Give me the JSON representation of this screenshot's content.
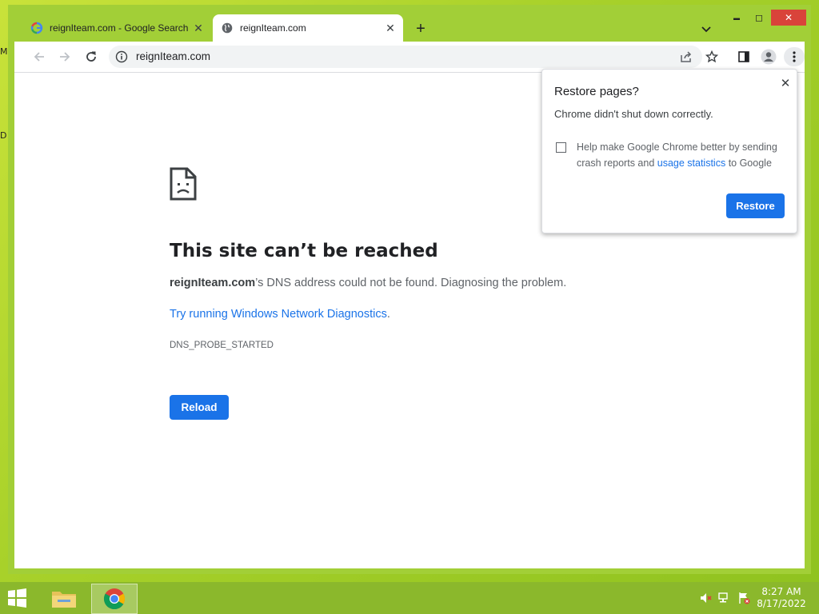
{
  "desktop": {
    "marks": [
      "M",
      "D"
    ]
  },
  "tabs": [
    {
      "title": "reignIteam.com - Google Search",
      "icon": "google-icon",
      "close": "✕"
    },
    {
      "title": "reignIteam.com",
      "icon": "globe-icon",
      "close": "✕",
      "active": true
    }
  ],
  "newtab_label": "+",
  "window_controls": {
    "minimize": "▬",
    "maximize": "◻",
    "close": "✕"
  },
  "address": {
    "url": "reignIteam.com"
  },
  "error": {
    "title": "This site can’t be reached",
    "domain": "reignIteam.com",
    "description": "’s DNS address could not be found. Diagnosing the problem.",
    "link": "Try running Windows Network Diagnostics",
    "link_suffix": ".",
    "code": "DNS_PROBE_STARTED",
    "reload_label": "Reload"
  },
  "popup": {
    "title": "Restore pages?",
    "message": "Chrome didn't shut down correctly.",
    "checkbox_text_1": "Help make Google Chrome better by sending crash reports and ",
    "checkbox_link": "usage statistics",
    "checkbox_text_2": " to Google",
    "checked": false,
    "restore_label": "Restore",
    "close": "✕"
  },
  "taskbar": {
    "time": "8:27 AM",
    "date": "8/17/2022"
  },
  "colors": {
    "accent": "#1a73e8",
    "window_frame": "#a2cf37",
    "taskbar": "#8bb82c"
  }
}
